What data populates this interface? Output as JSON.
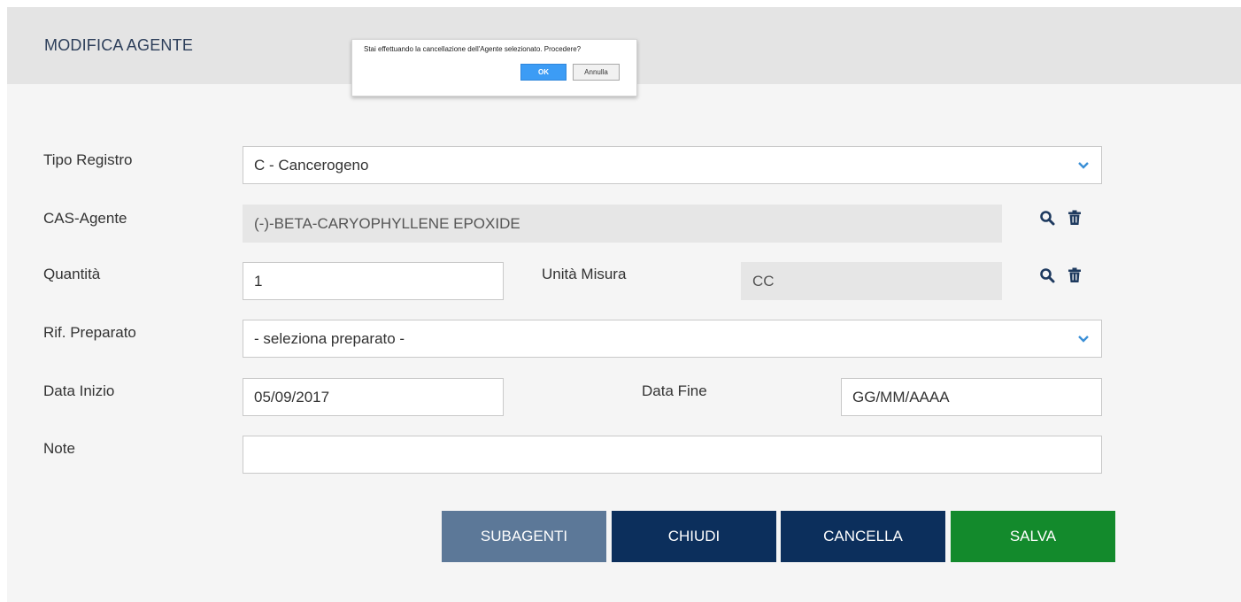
{
  "panel": {
    "title": "MODIFICA AGENTE"
  },
  "dialog": {
    "message": "Stai effettuando la cancellazione dell'Agente selezionato. Procedere?",
    "ok_label": "OK",
    "cancel_label": "Annulla"
  },
  "form": {
    "tipo_registro": {
      "label": "Tipo Registro",
      "value": "C - Cancerogeno"
    },
    "cas_agente": {
      "label": "CAS-Agente",
      "value": "(-)-BETA-CARYOPHYLLENE EPOXIDE"
    },
    "quantita": {
      "label": "Quantità",
      "value": "1"
    },
    "unita_misura": {
      "label": "Unità Misura",
      "value": "CC"
    },
    "rif_preparato": {
      "label": "Rif. Preparato",
      "value": "- seleziona preparato -"
    },
    "data_inizio": {
      "label": "Data Inizio",
      "value": "05/09/2017"
    },
    "data_fine": {
      "label": "Data Fine",
      "value": "GG/MM/AAAA"
    },
    "note": {
      "label": "Note",
      "value": ""
    }
  },
  "actions": {
    "subagenti": "SUBAGENTI",
    "chiudi": "CHIUDI",
    "cancella": "CANCELLA",
    "salva": "SALVA"
  },
  "colors": {
    "title": "#2c3e5a",
    "icon": "#1e3a5f",
    "subagenti": "#5c7898",
    "dark_button": "#0c2f5c",
    "save_button": "#138a2c",
    "dialog_ok": "#3c9cf5"
  },
  "icons": {
    "chevron": "chevron-down-icon",
    "search": "search-icon",
    "delete": "trash-icon"
  }
}
